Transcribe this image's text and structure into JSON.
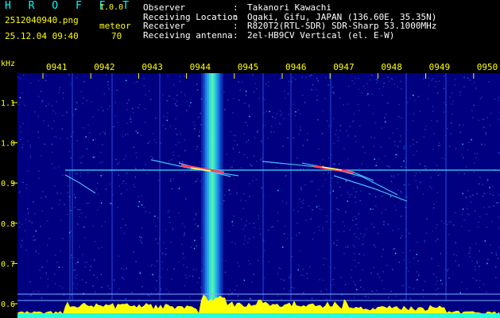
{
  "header": {
    "app_name": "HROFFT",
    "version": "1.0.0",
    "filename": "2512040940.png",
    "category_label": "meteor",
    "datetime": "25.12.04 09:40",
    "count": "70",
    "observer_label": "Observer",
    "observer": "Takanori Kawachi",
    "location_label": "Receiving Location",
    "location": "Ogaki, Gifu, JAPAN (136.60E, 35.35N)",
    "receiver_label": "Receiver",
    "receiver": "R820T2(RTL-SDR) SDR-Sharp 53.1000MHz",
    "antenna_label": "Receiving antenna",
    "antenna": "2el-HB9CV Vertical (el. E-W)",
    "separator": ":"
  },
  "spectrogram": {
    "unit_label": "kHz",
    "time_labels": [
      "0941",
      "0942",
      "0943",
      "0944",
      "0945",
      "0946",
      "0947",
      "0948",
      "0949",
      "0950"
    ],
    "freq_labels": [
      "1.1",
      "1.0",
      "0.9",
      "0.8",
      "0.7",
      "0.6"
    ],
    "colors": {
      "background": "#000080",
      "noise": "#1a30c0",
      "axis_text": "#ffff00",
      "reference_line": "#40e0ff",
      "power_trace": "#ffff00",
      "baseline": "#00ffff",
      "echo": "#ff4060"
    }
  }
}
